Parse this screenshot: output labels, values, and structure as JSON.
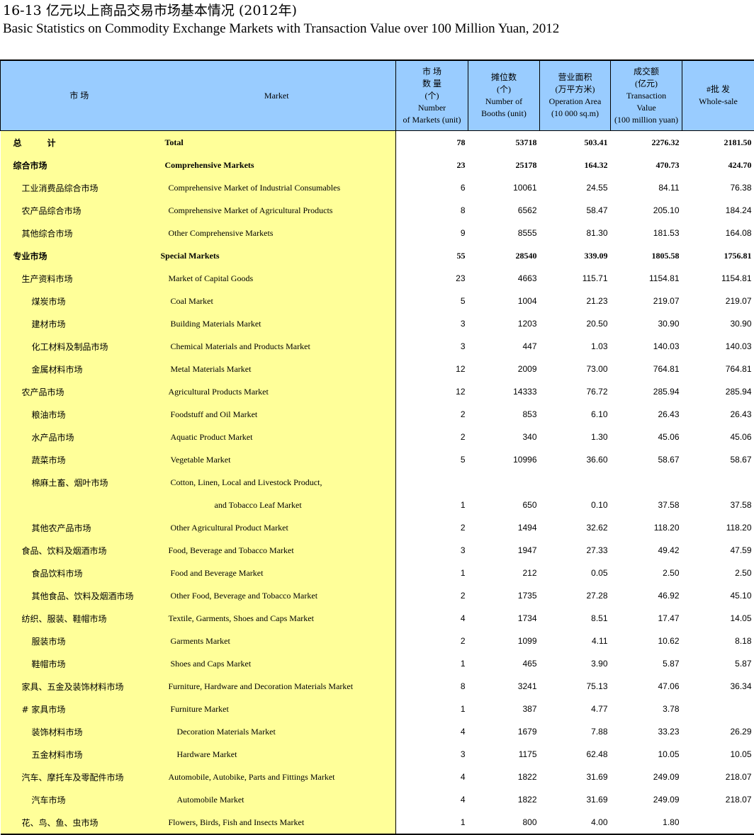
{
  "title_cn": "16-13 亿元以上商品交易市场基本情况 (2012年)",
  "title_en": "Basic Statistics on Commodity Exchange Markets with Transaction Value over 100 Million Yuan, 2012",
  "header": {
    "market_cn": "市 场",
    "market_en": "Market",
    "col1": [
      "市 场",
      "数 量",
      "(个)",
      "Number",
      "of Markets (unit)"
    ],
    "col2": [
      "摊位数",
      "(个)",
      "Number of",
      "Booths (unit)"
    ],
    "col3": [
      "营业面积",
      "(万平方米)",
      "Operation Area",
      "(10 000 sq.m)"
    ],
    "col4": [
      "成交额",
      "(亿元)",
      "Transaction",
      "Value",
      "(100 million yuan)"
    ],
    "col5": [
      "#批 发",
      "Whole-sale"
    ]
  },
  "rows": [
    {
      "cn": "总　　　计",
      "en": "Total",
      "markets": "78",
      "booths": "53718",
      "area": "503.41",
      "value": "2276.32",
      "wholesale": "2181.50"
    },
    {
      "cn": "综合市场",
      "en": "Comprehensive Markets",
      "markets": "23",
      "booths": "25178",
      "area": "164.32",
      "value": "470.73",
      "wholesale": "424.70"
    },
    {
      "cn": "工业消费品综合市场",
      "en": "Comprehensive Market of Industrial Consumables",
      "markets": "6",
      "booths": "10061",
      "area": "24.55",
      "value": "84.11",
      "wholesale": "76.38"
    },
    {
      "cn": "农产品综合市场",
      "en": "Comprehensive Market of Agricultural Products",
      "markets": "8",
      "booths": "6562",
      "area": "58.47",
      "value": "205.10",
      "wholesale": "184.24"
    },
    {
      "cn": "其他综合市场",
      "en": "Other Comprehensive Markets",
      "markets": "9",
      "booths": "8555",
      "area": "81.30",
      "value": "181.53",
      "wholesale": "164.08"
    },
    {
      "cn": "专业市场",
      "en": "Special Markets",
      "markets": "55",
      "booths": "28540",
      "area": "339.09",
      "value": "1805.58",
      "wholesale": "1756.81"
    },
    {
      "cn": "生产资料市场",
      "en": "Market of Capital Goods",
      "markets": "23",
      "booths": "4663",
      "area": "115.71",
      "value": "1154.81",
      "wholesale": "1154.81"
    },
    {
      "cn": "煤炭市场",
      "en": "Coal Market",
      "markets": "5",
      "booths": "1004",
      "area": "21.23",
      "value": "219.07",
      "wholesale": "219.07"
    },
    {
      "cn": "建材市场",
      "en": "Building Materials Market",
      "markets": "3",
      "booths": "1203",
      "area": "20.50",
      "value": "30.90",
      "wholesale": "30.90"
    },
    {
      "cn": "化工材料及制品市场",
      "en": "Chemical Materials and Products Market",
      "markets": "3",
      "booths": "447",
      "area": "1.03",
      "value": "140.03",
      "wholesale": "140.03"
    },
    {
      "cn": "金属材料市场",
      "en": "Metal Materials Market",
      "markets": "12",
      "booths": "2009",
      "area": "73.00",
      "value": "764.81",
      "wholesale": "764.81"
    },
    {
      "cn": "农产品市场",
      "en": "Agricultural Products Market",
      "markets": "12",
      "booths": "14333",
      "area": "76.72",
      "value": "285.94",
      "wholesale": "285.94"
    },
    {
      "cn": "粮油市场",
      "en": "Foodstuff and Oil Market",
      "markets": "2",
      "booths": "853",
      "area": "6.10",
      "value": "26.43",
      "wholesale": "26.43"
    },
    {
      "cn": "水产品市场",
      "en": "Aquatic Product Market",
      "markets": "2",
      "booths": "340",
      "area": "1.30",
      "value": "45.06",
      "wholesale": "45.06"
    },
    {
      "cn": "蔬菜市场",
      "en": "Vegetable Market",
      "markets": "5",
      "booths": "10996",
      "area": "36.60",
      "value": "58.67",
      "wholesale": "58.67"
    },
    {
      "cn": "棉麻土畜、烟叶市场",
      "en": "Cotton, Linen, Local and Livestock Product,",
      "markets": "",
      "booths": "",
      "area": "",
      "value": "",
      "wholesale": ""
    },
    {
      "cn": "",
      "en": "and Tobacco Leaf Market",
      "markets": "1",
      "booths": "650",
      "area": "0.10",
      "value": "37.58",
      "wholesale": "37.58"
    },
    {
      "cn": "其他农产品市场",
      "en": "Other Agricultural Product Market",
      "markets": "2",
      "booths": "1494",
      "area": "32.62",
      "value": "118.20",
      "wholesale": "118.20"
    },
    {
      "cn": "食品、饮料及烟酒市场",
      "en": "Food, Beverage and Tobacco Market",
      "markets": "3",
      "booths": "1947",
      "area": "27.33",
      "value": "49.42",
      "wholesale": "47.59"
    },
    {
      "cn": "食品饮料市场",
      "en": "Food and Beverage Market",
      "markets": "1",
      "booths": "212",
      "area": "0.05",
      "value": "2.50",
      "wholesale": "2.50"
    },
    {
      "cn": "其他食品、饮料及烟酒市场",
      "en": "Other Food, Beverage and Tobacco Market",
      "markets": "2",
      "booths": "1735",
      "area": "27.28",
      "value": "46.92",
      "wholesale": "45.10"
    },
    {
      "cn": "纺织、服装、鞋帽市场",
      "en": "Textile, Garments, Shoes and Caps Market",
      "markets": "4",
      "booths": "1734",
      "area": "8.51",
      "value": "17.47",
      "wholesale": "14.05"
    },
    {
      "cn": "服装市场",
      "en": "Garments Market",
      "markets": "2",
      "booths": "1099",
      "area": "4.11",
      "value": "10.62",
      "wholesale": "8.18"
    },
    {
      "cn": "鞋帽市场",
      "en": "Shoes and Caps Market",
      "markets": "1",
      "booths": "465",
      "area": "3.90",
      "value": "5.87",
      "wholesale": "5.87"
    },
    {
      "cn": "家具、五金及装饰材料市场",
      "en": "Furniture, Hardware and Decoration Materials Market",
      "markets": "8",
      "booths": "3241",
      "area": "75.13",
      "value": "47.06",
      "wholesale": "36.34"
    },
    {
      "cn": "# 家具市场",
      "en": "Furniture Market",
      "markets": "1",
      "booths": "387",
      "area": "4.77",
      "value": "3.78",
      "wholesale": ""
    },
    {
      "cn": "装饰材料市场",
      "en": "Decoration Materials Market",
      "markets": "4",
      "booths": "1679",
      "area": "7.88",
      "value": "33.23",
      "wholesale": "26.29"
    },
    {
      "cn": "五金材料市场",
      "en": "Hardware Market",
      "markets": "3",
      "booths": "1175",
      "area": "62.48",
      "value": "10.05",
      "wholesale": "10.05"
    },
    {
      "cn": "汽车、摩托车及零配件市场",
      "en": "Automobile, Autobike,  Parts and Fittings Market",
      "markets": "4",
      "booths": "1822",
      "area": "31.69",
      "value": "249.09",
      "wholesale": "218.07"
    },
    {
      "cn": "汽车市场",
      "en": "Automobile Market",
      "markets": "4",
      "booths": "1822",
      "area": "31.69",
      "value": "249.09",
      "wholesale": "218.07"
    },
    {
      "cn": "花、鸟、鱼、虫市场",
      "en": "Flowers, Birds, Fish and Insects Market",
      "markets": "1",
      "booths": "800",
      "area": "4.00",
      "value": "1.80",
      "wholesale": ""
    }
  ]
}
